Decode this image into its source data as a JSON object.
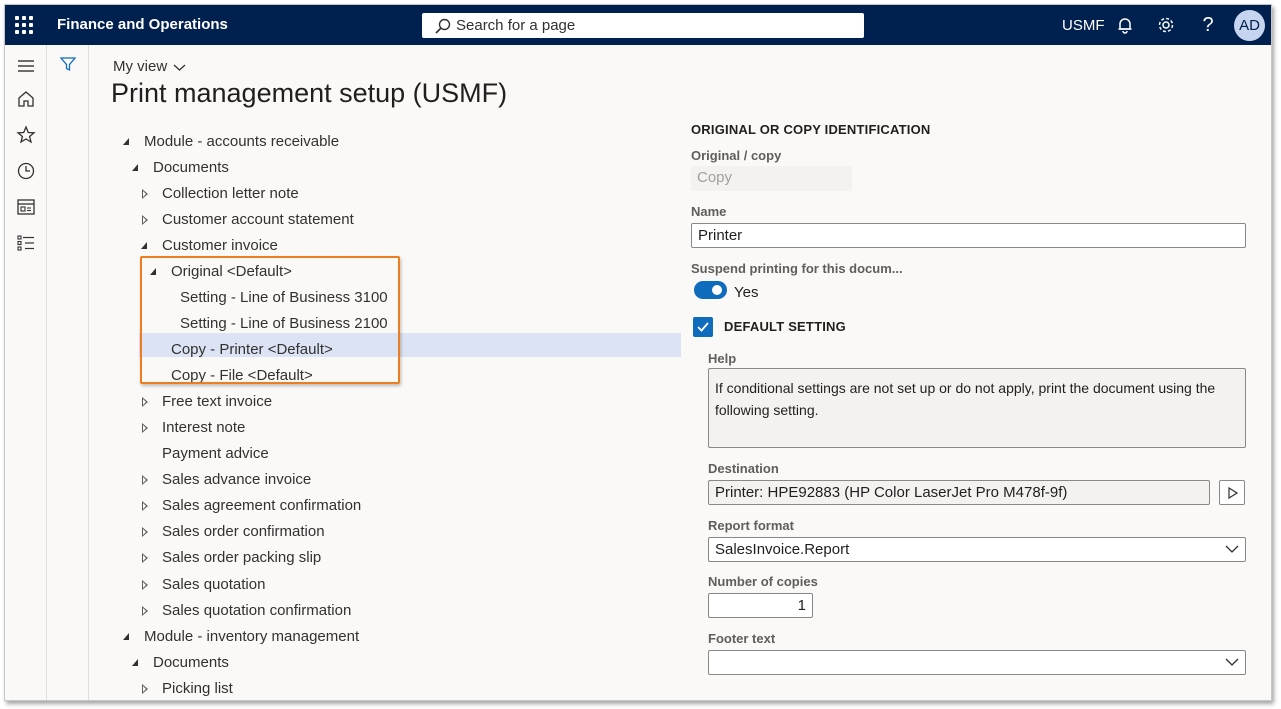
{
  "topbar": {
    "app_title": "Finance and Operations",
    "search_placeholder": "Search for a page",
    "company": "USMF",
    "help_glyph": "?",
    "avatar_initials": "AD"
  },
  "header": {
    "my_view": "My view",
    "page_title": "Print management setup (USMF)"
  },
  "tree": [
    {
      "label": "Module - accounts receivable",
      "expander": "expanded"
    },
    {
      "label": "Documents",
      "expander": "expanded"
    },
    {
      "label": "Collection letter note",
      "expander": "collapsed"
    },
    {
      "label": "Customer account statement",
      "expander": "collapsed"
    },
    {
      "label": "Customer invoice",
      "expander": "expanded"
    },
    {
      "label": "Original <Default>",
      "expander": "expanded"
    },
    {
      "label": "Setting - Line of Business 3100",
      "expander": "none"
    },
    {
      "label": "Setting - Line of Business 2100",
      "expander": "none"
    },
    {
      "label": "Copy - Printer <Default>",
      "expander": "none",
      "selected": true
    },
    {
      "label": "Copy - File <Default>",
      "expander": "none"
    },
    {
      "label": "Free text invoice",
      "expander": "collapsed"
    },
    {
      "label": "Interest note",
      "expander": "collapsed"
    },
    {
      "label": "Payment advice",
      "expander": "none"
    },
    {
      "label": "Sales advance invoice",
      "expander": "collapsed"
    },
    {
      "label": "Sales agreement confirmation",
      "expander": "collapsed"
    },
    {
      "label": "Sales order confirmation",
      "expander": "collapsed"
    },
    {
      "label": "Sales order packing slip",
      "expander": "collapsed"
    },
    {
      "label": "Sales quotation",
      "expander": "collapsed"
    },
    {
      "label": "Sales quotation confirmation",
      "expander": "collapsed"
    },
    {
      "label": "Module - inventory management",
      "expander": "expanded"
    },
    {
      "label": "Documents",
      "expander": "expanded"
    },
    {
      "label": "Picking list",
      "expander": "collapsed"
    }
  ],
  "details": {
    "section_title": "ORIGINAL OR COPY IDENTIFICATION",
    "original_copy_label": "Original / copy",
    "original_copy_value": "Copy",
    "name_label": "Name",
    "name_value": "Printer",
    "suspend_label": "Suspend printing for this docum...",
    "suspend_value": "Yes",
    "default_setting_label": "DEFAULT SETTING",
    "help_label": "Help",
    "help_text": "If conditional settings are not set up or do not apply, print the document using the following setting.",
    "destination_label": "Destination",
    "destination_value": "Printer: HPE92883 (HP Color LaserJet Pro M478f-9f)",
    "report_format_label": "Report format",
    "report_format_value": "SalesInvoice.Report",
    "copies_label": "Number of copies",
    "copies_value": "1",
    "footer_label": "Footer text",
    "footer_value": ""
  },
  "colors": {
    "topbar": "#002050",
    "accent": "#0f6cbd",
    "selection": "#dbe3f4",
    "highlight_box": "#ee7d22"
  }
}
